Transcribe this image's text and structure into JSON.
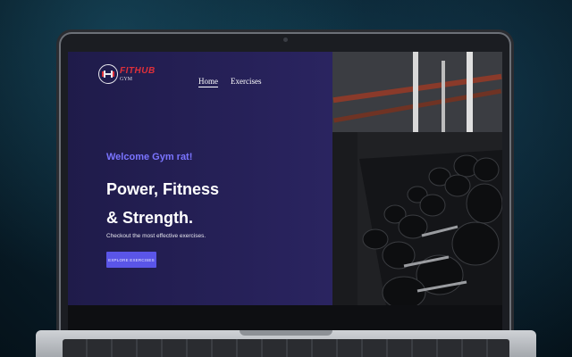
{
  "site": {
    "brand": "FITHUB",
    "brand_sub": "GYM",
    "logo_icon": "dumbbell-icon"
  },
  "nav": {
    "items": [
      {
        "label": "Home",
        "active": true
      },
      {
        "label": "Exercises",
        "active": false
      }
    ]
  },
  "hero": {
    "welcome": "Welcome Gym rat!",
    "headline_line1": "Power, Fitness",
    "headline_line2": "& Strength.",
    "subtitle": "Checkout the most effective exercises.",
    "cta_label": "EXPLORE EXERCISES"
  },
  "colors": {
    "panel": "#231f52",
    "accent": "#5a55e8",
    "welcome": "#7a74ff",
    "brand": "#e0303a"
  }
}
